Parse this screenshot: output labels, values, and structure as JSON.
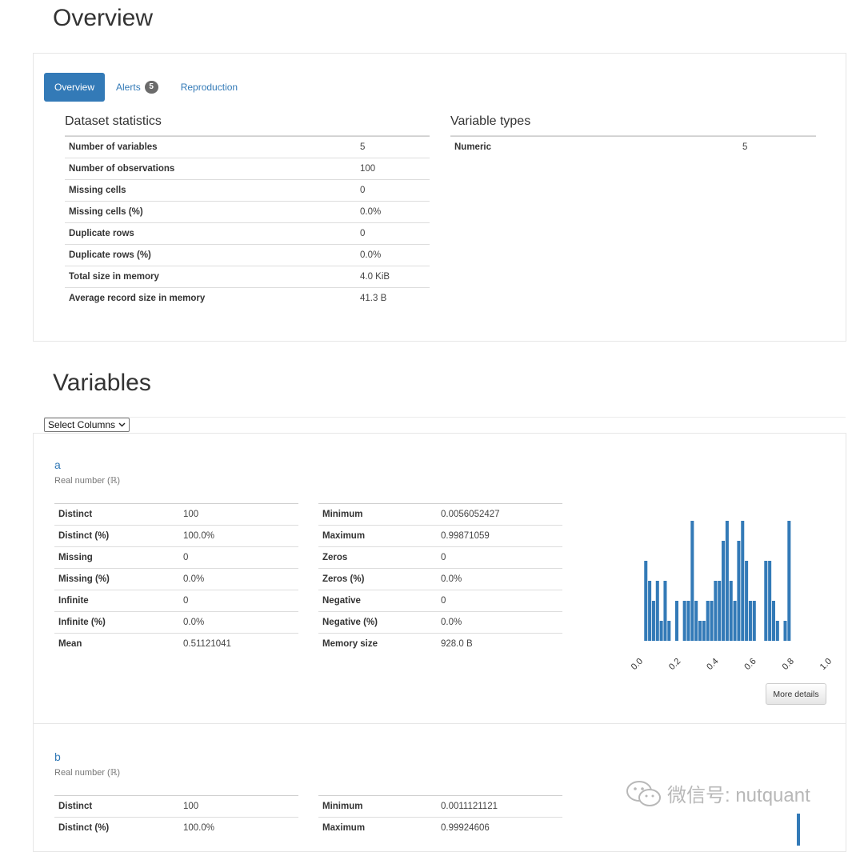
{
  "overview": {
    "title": "Overview",
    "tabs": [
      {
        "label": "Overview",
        "active": true
      },
      {
        "label": "Alerts",
        "badge": "5"
      },
      {
        "label": "Reproduction"
      }
    ],
    "dataset_statistics": {
      "heading": "Dataset statistics",
      "rows": [
        {
          "label": "Number of variables",
          "value": "5"
        },
        {
          "label": "Number of observations",
          "value": "100"
        },
        {
          "label": "Missing cells",
          "value": "0"
        },
        {
          "label": "Missing cells (%)",
          "value": "0.0%"
        },
        {
          "label": "Duplicate rows",
          "value": "0"
        },
        {
          "label": "Duplicate rows (%)",
          "value": "0.0%"
        },
        {
          "label": "Total size in memory",
          "value": "4.0 KiB"
        },
        {
          "label": "Average record size in memory",
          "value": "41.3 B"
        }
      ]
    },
    "variable_types": {
      "heading": "Variable types",
      "rows": [
        {
          "label": "Numeric",
          "value": "5"
        }
      ]
    }
  },
  "variables": {
    "title": "Variables",
    "select_label": "Select Columns",
    "items": [
      {
        "name": "a",
        "type": "Real number (ℝ)",
        "left_stats": [
          {
            "label": "Distinct",
            "value": "100",
            "alert": true
          },
          {
            "label": "Distinct (%)",
            "value": "100.0%",
            "alert": true
          },
          {
            "label": "Missing",
            "value": "0"
          },
          {
            "label": "Missing (%)",
            "value": "0.0%"
          },
          {
            "label": "Infinite",
            "value": "0"
          },
          {
            "label": "Infinite (%)",
            "value": "0.0%"
          },
          {
            "label": "Mean",
            "value": "0.51121041"
          }
        ],
        "right_stats": [
          {
            "label": "Minimum",
            "value": "0.0056052427"
          },
          {
            "label": "Maximum",
            "value": "0.99871059"
          },
          {
            "label": "Zeros",
            "value": "0"
          },
          {
            "label": "Zeros (%)",
            "value": "0.0%"
          },
          {
            "label": "Negative",
            "value": "0"
          },
          {
            "label": "Negative (%)",
            "value": "0.0%"
          },
          {
            "label": "Memory size",
            "value": "928.0 B"
          }
        ],
        "more_details_label": "More details"
      },
      {
        "name": "b",
        "type": "Real number (ℝ)",
        "left_stats": [
          {
            "label": "Distinct",
            "value": "100",
            "alert": true
          },
          {
            "label": "Distinct (%)",
            "value": "100.0%",
            "alert": true
          }
        ],
        "right_stats": [
          {
            "label": "Minimum",
            "value": "0.0011121121"
          },
          {
            "label": "Maximum",
            "value": "0.99924606"
          }
        ]
      }
    ]
  },
  "chart_data": {
    "type": "bar",
    "x_range": [
      0.0,
      1.0
    ],
    "tick_labels": [
      "0.0",
      "0.2",
      "0.4",
      "0.6",
      "0.8",
      "1.0"
    ],
    "bin_count": 50,
    "values": [
      0,
      4,
      3,
      2,
      3,
      1,
      3,
      1,
      0,
      2,
      0,
      2,
      2,
      6,
      2,
      1,
      1,
      2,
      2,
      3,
      3,
      5,
      6,
      3,
      2,
      5,
      6,
      4,
      2,
      2,
      0,
      0,
      4,
      4,
      2,
      1,
      0,
      1,
      6,
      0,
      0,
      0,
      0,
      0,
      0,
      0,
      0,
      0,
      0,
      0
    ],
    "color": "#337ab7"
  },
  "watermark": "微信号: nutquant"
}
